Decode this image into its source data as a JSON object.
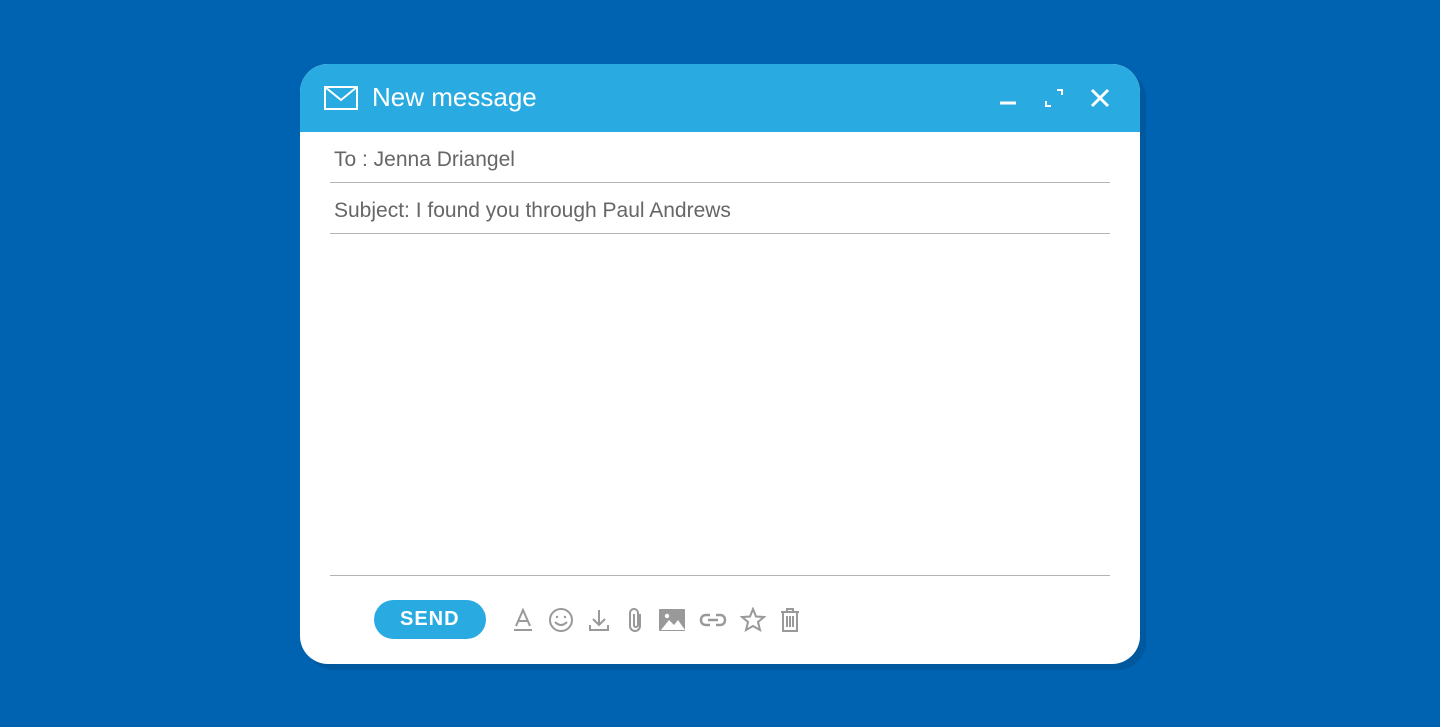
{
  "header": {
    "title": "New message"
  },
  "fields": {
    "to_label": "To :",
    "to_value": "Jenna Driangel",
    "subject_label": "Subject:",
    "subject_value": "I found you through Paul Andrews",
    "body_value": ""
  },
  "toolbar": {
    "send_label": "SEND",
    "icons": {
      "format": "text-format-icon",
      "emoji": "emoji-icon",
      "download": "download-icon",
      "attach": "attach-icon",
      "image": "image-icon",
      "link": "link-icon",
      "star": "star-icon",
      "trash": "trash-icon"
    }
  },
  "colors": {
    "page_bg": "#0063b1",
    "accent": "#29abe2",
    "icon": "#999999",
    "field_border": "#b3b3b3",
    "field_text": "#666666"
  }
}
